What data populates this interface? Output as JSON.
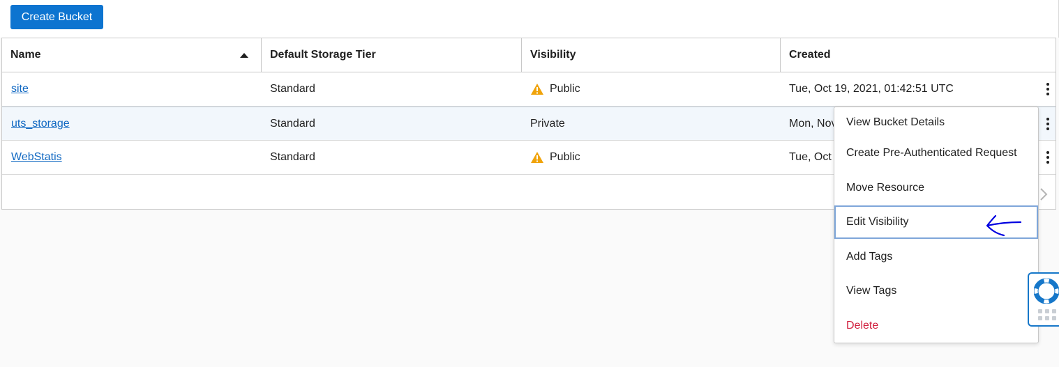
{
  "toolbar": {
    "create_bucket_label": "Create Bucket"
  },
  "table": {
    "columns": {
      "name": "Name",
      "tier": "Default Storage Tier",
      "visibility": "Visibility",
      "created": "Created"
    },
    "sort": {
      "column": "Name",
      "direction": "ascending"
    },
    "rows": [
      {
        "name": "site",
        "tier": "Standard",
        "visibility": "Public",
        "warning": true,
        "created": "Tue, Oct 19, 2021, 01:42:51 UTC"
      },
      {
        "name": "uts_storage",
        "tier": "Standard",
        "visibility": "Private",
        "warning": false,
        "created": "Mon, Nov"
      },
      {
        "name": "WebStatis",
        "tier": "Standard",
        "visibility": "Public",
        "warning": true,
        "created": "Tue, Oct"
      }
    ],
    "selected_row": "uts_storage"
  },
  "actions_menu": {
    "items": [
      {
        "label": "View Bucket Details"
      },
      {
        "label": "Create Pre-Authenticated Request"
      },
      {
        "label": "Move Resource"
      },
      {
        "label": "Edit Visibility",
        "focused": true
      },
      {
        "label": "Add Tags"
      },
      {
        "label": "View Tags"
      },
      {
        "label": "Delete",
        "danger": true
      }
    ]
  },
  "icons": {
    "warning": "warning-triangle-icon",
    "sort": "sort-ascending-icon",
    "kebab": "more-vertical-icon",
    "help": "lifebuoy-icon",
    "pager_next": "chevron-right-icon"
  },
  "colors": {
    "primary_button": "#0d74d0",
    "link": "#1068c2",
    "warning": "#f0a30a",
    "danger": "#d11e3d",
    "annotation": "#0000e0"
  }
}
